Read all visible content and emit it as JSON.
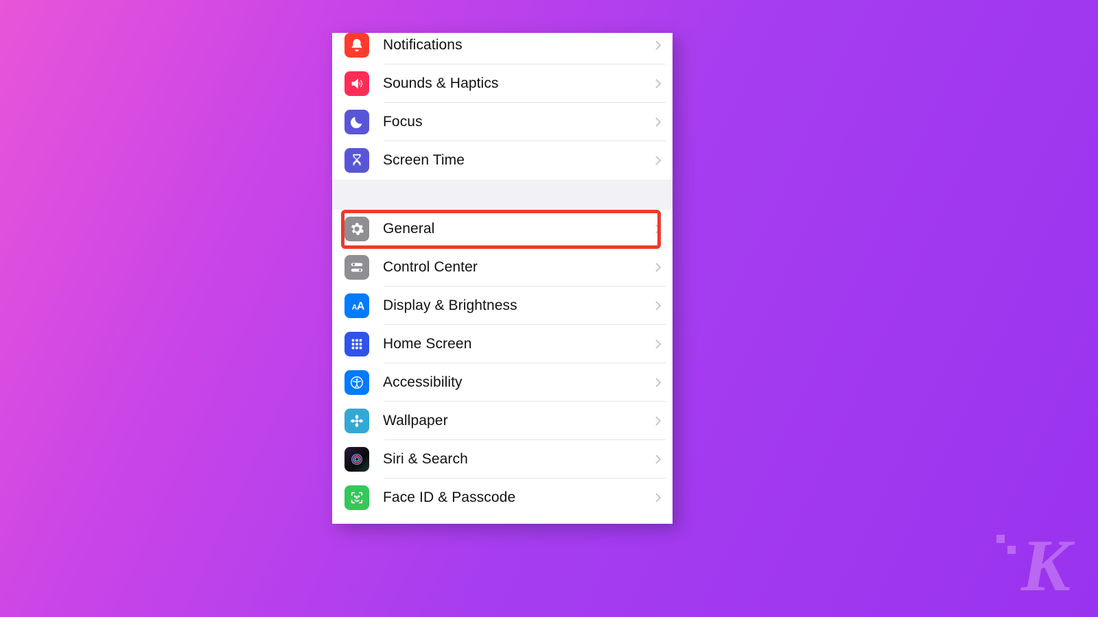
{
  "groups": [
    {
      "items": [
        {
          "id": "notifications",
          "label": "Notifications",
          "icon": "bell-icon",
          "color": "red"
        },
        {
          "id": "sounds-haptics",
          "label": "Sounds & Haptics",
          "icon": "speaker-icon",
          "color": "red2"
        },
        {
          "id": "focus",
          "label": "Focus",
          "icon": "moon-icon",
          "color": "indigo"
        },
        {
          "id": "screen-time",
          "label": "Screen Time",
          "icon": "hourglass-icon",
          "color": "indigo"
        }
      ]
    },
    {
      "items": [
        {
          "id": "general",
          "label": "General",
          "icon": "gear-icon",
          "color": "gray",
          "highlighted": true
        },
        {
          "id": "control-center",
          "label": "Control Center",
          "icon": "switches-icon",
          "color": "gray"
        },
        {
          "id": "display-brightness",
          "label": "Display & Brightness",
          "icon": "text-size-icon",
          "color": "blue"
        },
        {
          "id": "home-screen",
          "label": "Home Screen",
          "icon": "grid-icon",
          "color": "blue-deep"
        },
        {
          "id": "accessibility",
          "label": "Accessibility",
          "icon": "accessibility-icon",
          "color": "blue"
        },
        {
          "id": "wallpaper",
          "label": "Wallpaper",
          "icon": "flower-icon",
          "color": "cyan"
        },
        {
          "id": "siri-search",
          "label": "Siri & Search",
          "icon": "siri-icon",
          "color": "black"
        },
        {
          "id": "face-id",
          "label": "Face ID & Passcode",
          "icon": "face-id-icon",
          "color": "green"
        }
      ]
    }
  ],
  "highlight_color": "#ef3a28",
  "watermark": "K"
}
